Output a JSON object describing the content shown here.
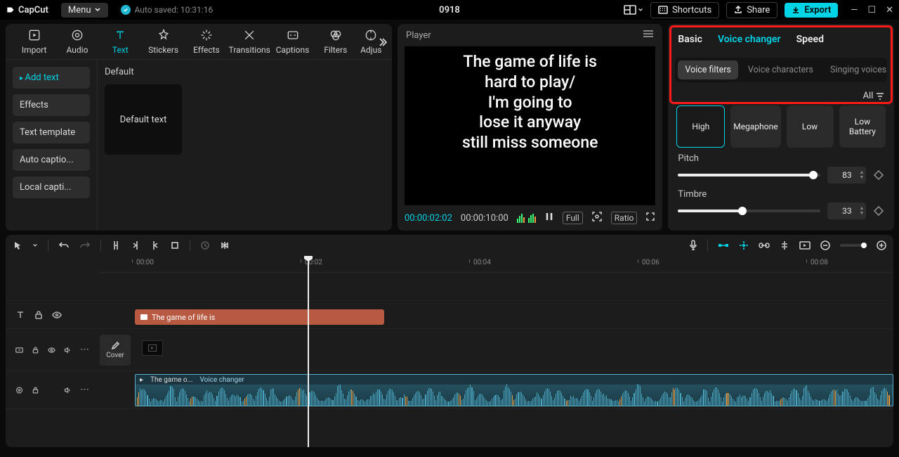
{
  "app": {
    "name": "CapCut",
    "menu": "Menu",
    "autosave": "Auto saved: 10:31:16",
    "project": "0918"
  },
  "topbar": {
    "shortcuts": "Shortcuts",
    "share": "Share",
    "export": "Export"
  },
  "cats": {
    "import": "Import",
    "audio": "Audio",
    "text": "Text",
    "stickers": "Stickers",
    "effects": "Effects",
    "transitions": "Transitions",
    "captions": "Captions",
    "filters": "Filters",
    "adjust": "Adjus"
  },
  "textSide": {
    "add": "Add text",
    "effects": "Effects",
    "template": "Text template",
    "auto": "Auto captio...",
    "local": "Local capti..."
  },
  "textContent": {
    "section": "Default",
    "card": "Default text"
  },
  "player": {
    "title": "Player",
    "overlay": "The game of life is\nhard to play/\nI'm going to\nlose it anyway\nstill miss someone",
    "current": "00:00:02:02",
    "duration": "00:00:10:00",
    "full": "Full",
    "ratio": "Ratio"
  },
  "inspector": {
    "tabs": {
      "basic": "Basic",
      "voice": "Voice changer",
      "speed": "Speed"
    },
    "subs": {
      "filters": "Voice filters",
      "chars": "Voice characters",
      "singing": "Singing voices"
    },
    "all": "All",
    "presets": {
      "high": "High",
      "mega": "Megaphone",
      "low": "Low",
      "lowbat": "Low Battery"
    },
    "pitch": {
      "label": "Pitch",
      "value": "83",
      "pct": 95
    },
    "timbre": {
      "label": "Timbre",
      "value": "33",
      "pct": 45
    }
  },
  "ruler": {
    "t0": "00:00",
    "t2": "00:02",
    "t4": "00:04",
    "t6": "00:06",
    "t8": "00:08"
  },
  "tracks": {
    "textClip": "The game of life is",
    "cover": "Cover",
    "audioClipA": "The game o...",
    "audioClipB": "Voice changer"
  }
}
